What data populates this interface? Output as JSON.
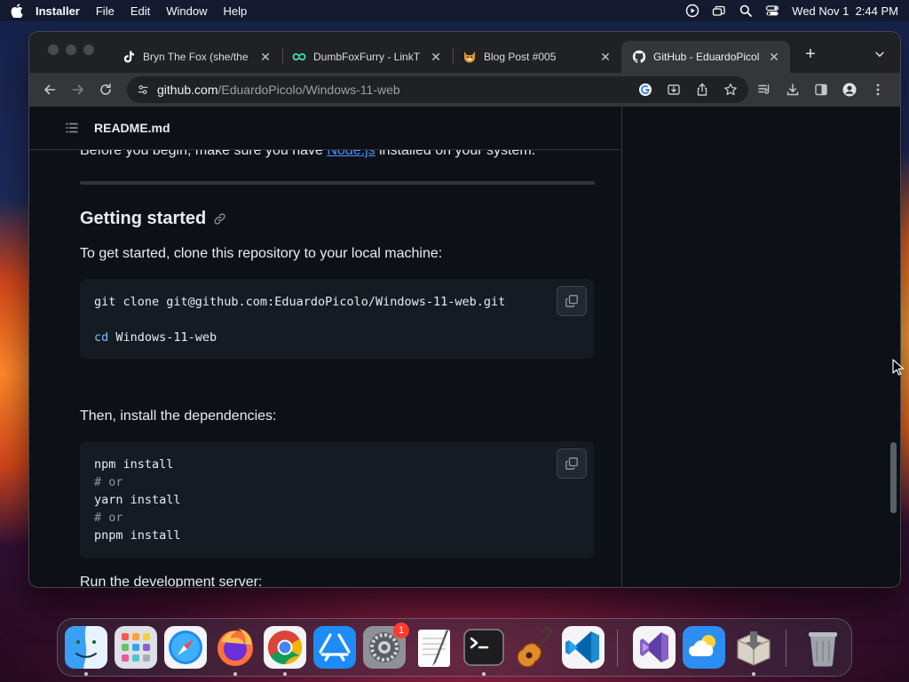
{
  "menubar": {
    "app_name": "Installer",
    "menus": [
      "File",
      "Edit",
      "Window",
      "Help"
    ],
    "datetime": "Wed Nov 1  2:44 PM"
  },
  "tabs": [
    {
      "label": "Bryn The Fox (she/the",
      "icon": "tiktok-icon",
      "active": false
    },
    {
      "label": "DumbFoxFurry - LinkT",
      "icon": "linktree-icon",
      "active": false
    },
    {
      "label": "Blog Post #005",
      "icon": "fox-icon",
      "active": false
    },
    {
      "label": "GitHub - EduardoPicol",
      "icon": "github-icon",
      "active": true
    }
  ],
  "omnibox": {
    "host": "github.com",
    "path": "/EduardoPicolo/Windows-11-web"
  },
  "readme": {
    "filename": "README.md",
    "intro_before": "Before you begin, make sure you have ",
    "intro_link": "Node.js",
    "intro_after": " installed on your system.",
    "heading": "Getting started",
    "clone_text": "To get started, clone this repository to your local machine:",
    "clone_code": [
      {
        "text": "git clone git@github.com:EduardoPicolo/Windows-11-web.git",
        "type": "plain"
      },
      {
        "text": "",
        "type": "plain"
      },
      {
        "kw": "cd",
        "text": " Windows-11-web",
        "type": "kw"
      }
    ],
    "deps_text": "Then, install the dependencies:",
    "deps_code": [
      {
        "text": "npm install",
        "type": "plain"
      },
      {
        "text": "# or",
        "type": "cmt"
      },
      {
        "text": "yarn install",
        "type": "plain"
      },
      {
        "text": "# or",
        "type": "cmt"
      },
      {
        "text": "pnpm install",
        "type": "plain"
      }
    ],
    "dev_text": "Run the development server:"
  },
  "dock": {
    "apps": [
      "Finder",
      "Launchpad",
      "Safari",
      "Firefox",
      "Google Chrome",
      "App Store",
      "System Settings",
      "TextEdit",
      "Terminal",
      "GarageBand",
      "Visual Studio Code",
      "Visual Studio",
      "Weather",
      "Installer",
      "Trash"
    ],
    "settings_badge": "1"
  },
  "colors": {
    "page_bg": "#0d1117",
    "link": "#4493f8",
    "text": "#e6edf3"
  }
}
